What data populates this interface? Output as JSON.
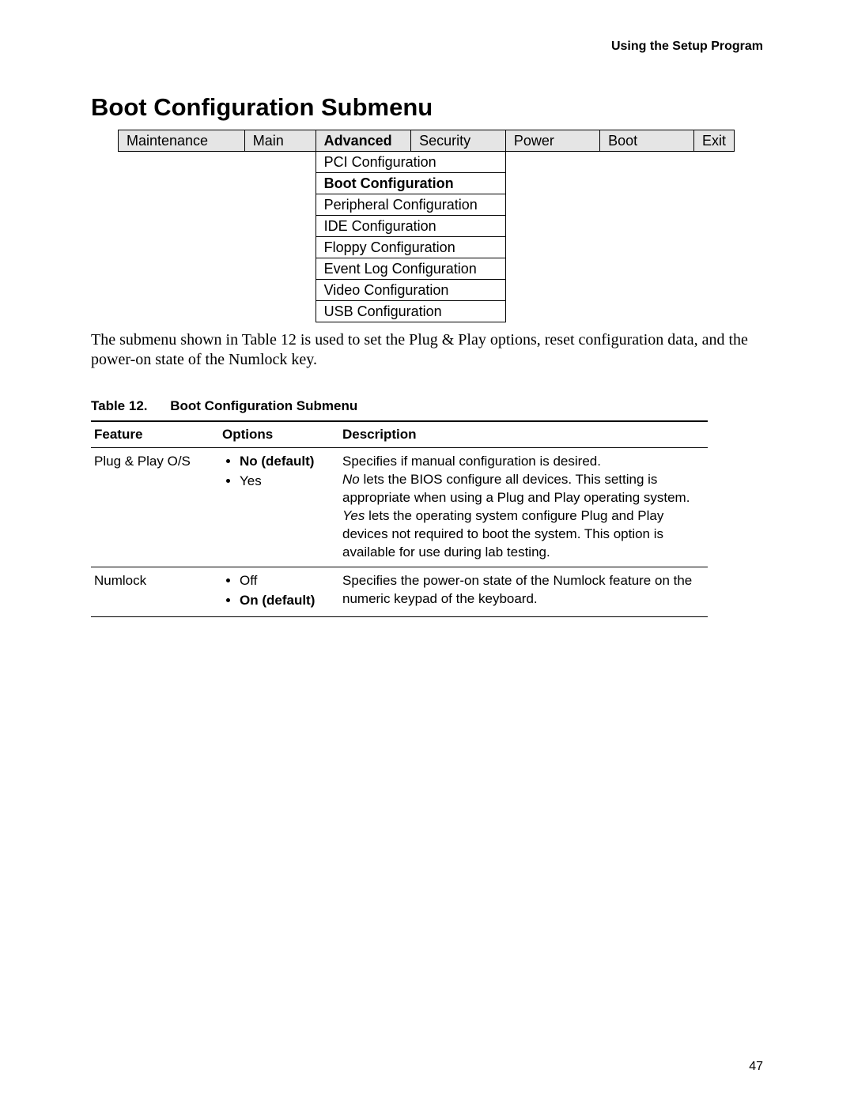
{
  "running_head": "Using the Setup Program",
  "title": "Boot Configuration Submenu",
  "nav": {
    "tabs": [
      "Maintenance",
      "Main",
      "Advanced",
      "Security",
      "Power",
      "Boot",
      "Exit"
    ],
    "active_tab_index": 2,
    "submenu": [
      "PCI Configuration",
      "Boot Configuration",
      "Peripheral Configuration",
      "IDE Configuration",
      "Floppy  Configuration",
      "Event Log Configuration",
      "Video Configuration",
      "USB Configuration"
    ],
    "submenu_active_index": 1
  },
  "paragraph": "The submenu shown in Table 12 is used to set the Plug & Play options, reset configuration data, and the power-on state of the Numlock key.",
  "table_caption": {
    "number": "Table 12.",
    "name": "Boot Configuration Submenu"
  },
  "table": {
    "headers": [
      "Feature",
      "Options",
      "Description"
    ],
    "rows": [
      {
        "feature": "Plug & Play O/S",
        "options": [
          {
            "label": "No (default)",
            "bold": true
          },
          {
            "label": "Yes",
            "bold": false
          }
        ],
        "description": [
          {
            "text": "Specifies if manual configuration is desired."
          },
          {
            "italic_prefix": "No",
            "text": " lets the BIOS configure all devices.  This setting is appropriate when using a Plug and Play operating system."
          },
          {
            "italic_prefix": "Yes",
            "text": " lets the operating system configure Plug and Play devices not required to boot the system.  This option is available for use during lab testing."
          }
        ]
      },
      {
        "feature": "Numlock",
        "options": [
          {
            "label": "Off",
            "bold": false
          },
          {
            "label": "On (default)",
            "bold": true
          }
        ],
        "description": [
          {
            "text": "Specifies the power-on state of the Numlock feature on the numeric keypad of the keyboard."
          }
        ]
      }
    ]
  },
  "page_number": "47"
}
